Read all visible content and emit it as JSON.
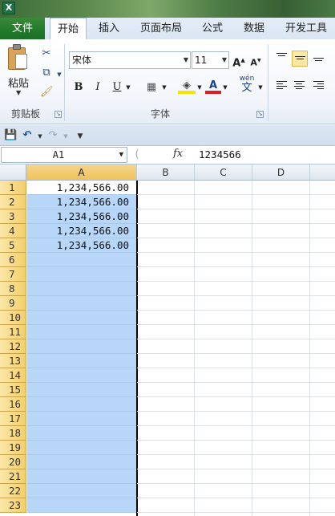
{
  "tabs": [
    {
      "label": "文件"
    },
    {
      "label": "开始"
    },
    {
      "label": "插入"
    },
    {
      "label": "页面布局"
    },
    {
      "label": "公式"
    },
    {
      "label": "数据"
    },
    {
      "label": "开发工具"
    }
  ],
  "ribbon": {
    "paste_label": "粘贴",
    "clipboard_group": "剪贴板",
    "font_group": "字体",
    "font_name": "宋体",
    "font_size": "11",
    "bold": "B",
    "italic": "I",
    "underline": "U",
    "font_color_glyph": "A",
    "phonetic_glyph": "wén",
    "phonetic_char": "文"
  },
  "formula_bar": {
    "name_box": "A1",
    "fx_label": "fx",
    "value": "1234566"
  },
  "columns": [
    "A",
    "B",
    "C",
    "D"
  ],
  "rows": [
    "1",
    "2",
    "3",
    "4",
    "5",
    "6",
    "7",
    "8",
    "9",
    "10",
    "11",
    "12",
    "13",
    "14",
    "15",
    "16",
    "17",
    "18",
    "19",
    "20",
    "21",
    "22",
    "23"
  ],
  "cells_A": [
    "1,234,566.00",
    "1,234,566.00",
    "1,234,566.00",
    "1,234,566.00",
    "1,234,566.00"
  ],
  "colors": {
    "selection": "#b8d7f8",
    "file_tab": "#217a2a",
    "header_selected": "#f0c35a"
  }
}
